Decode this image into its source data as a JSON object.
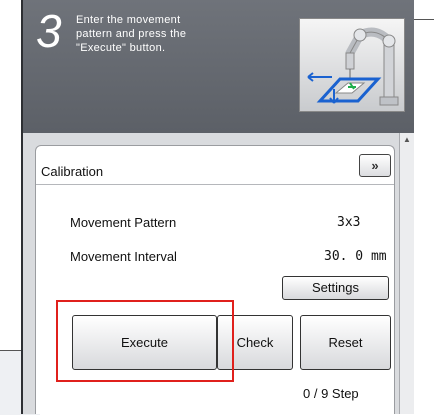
{
  "header": {
    "step_number": "3",
    "instruction": "Enter the movement\npattern and press the\n\"Execute\" button."
  },
  "card": {
    "title": "Calibration",
    "expand_label": "»",
    "rows": [
      {
        "label": "Movement Pattern",
        "value": "3x3"
      },
      {
        "label": "Movement Interval",
        "value": "30. 0  mm"
      }
    ],
    "settings_label": "Settings",
    "execute_label": "Execute",
    "check_label": "Check",
    "reset_label": "Reset",
    "step_counter": "0 /  9 Step"
  },
  "colors": {
    "highlight": "#e0201c",
    "header_bg": "#6f737a",
    "content_bg": "#d9dbde"
  },
  "icons": [
    "robot-arm-illustration",
    "scroll-up-arrow-icon",
    "double-chevron-right-icon"
  ]
}
